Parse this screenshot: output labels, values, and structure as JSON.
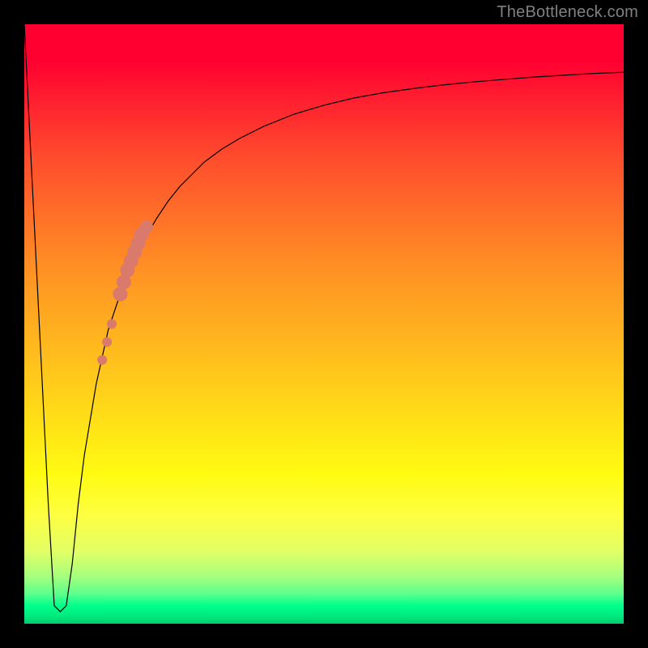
{
  "watermark": "TheBottleneck.com",
  "chart_data": {
    "type": "line",
    "title": "",
    "xlabel": "",
    "ylabel": "",
    "xlim": [
      0,
      100
    ],
    "ylim": [
      0,
      100
    ],
    "grid": false,
    "legend": false,
    "series": [
      {
        "name": "bottleneck-curve",
        "stroke": "#000000",
        "stroke_width": 1.2,
        "x": [
          0,
          1,
          2,
          3,
          4,
          5,
          6,
          7,
          8,
          9,
          10,
          12,
          14,
          16,
          18,
          20,
          22,
          24,
          26,
          28,
          30,
          33,
          36,
          40,
          45,
          50,
          55,
          60,
          65,
          70,
          75,
          80,
          85,
          90,
          95,
          100
        ],
        "values": [
          100,
          80,
          60,
          40,
          20,
          3,
          2,
          3,
          10,
          20,
          28,
          40,
          49,
          55,
          60,
          64,
          67.5,
          70.5,
          73,
          75,
          77,
          79.2,
          81,
          83,
          85,
          86.5,
          87.7,
          88.6,
          89.3,
          89.9,
          90.4,
          90.8,
          91.2,
          91.5,
          91.8,
          92
        ]
      }
    ],
    "scatter": {
      "name": "highlight-dots",
      "color": "#d97a6c",
      "points": [
        {
          "x": 13.0,
          "y": 44,
          "r": 6
        },
        {
          "x": 13.8,
          "y": 47,
          "r": 6
        },
        {
          "x": 14.6,
          "y": 50,
          "r": 6
        },
        {
          "x": 16.0,
          "y": 55,
          "r": 9
        },
        {
          "x": 16.6,
          "y": 57,
          "r": 9
        },
        {
          "x": 17.2,
          "y": 59,
          "r": 9
        },
        {
          "x": 17.8,
          "y": 60.5,
          "r": 9
        },
        {
          "x": 18.4,
          "y": 62,
          "r": 9
        },
        {
          "x": 19.0,
          "y": 63.5,
          "r": 9
        },
        {
          "x": 19.6,
          "y": 65,
          "r": 9
        },
        {
          "x": 20.4,
          "y": 66.2,
          "r": 8
        }
      ]
    }
  }
}
